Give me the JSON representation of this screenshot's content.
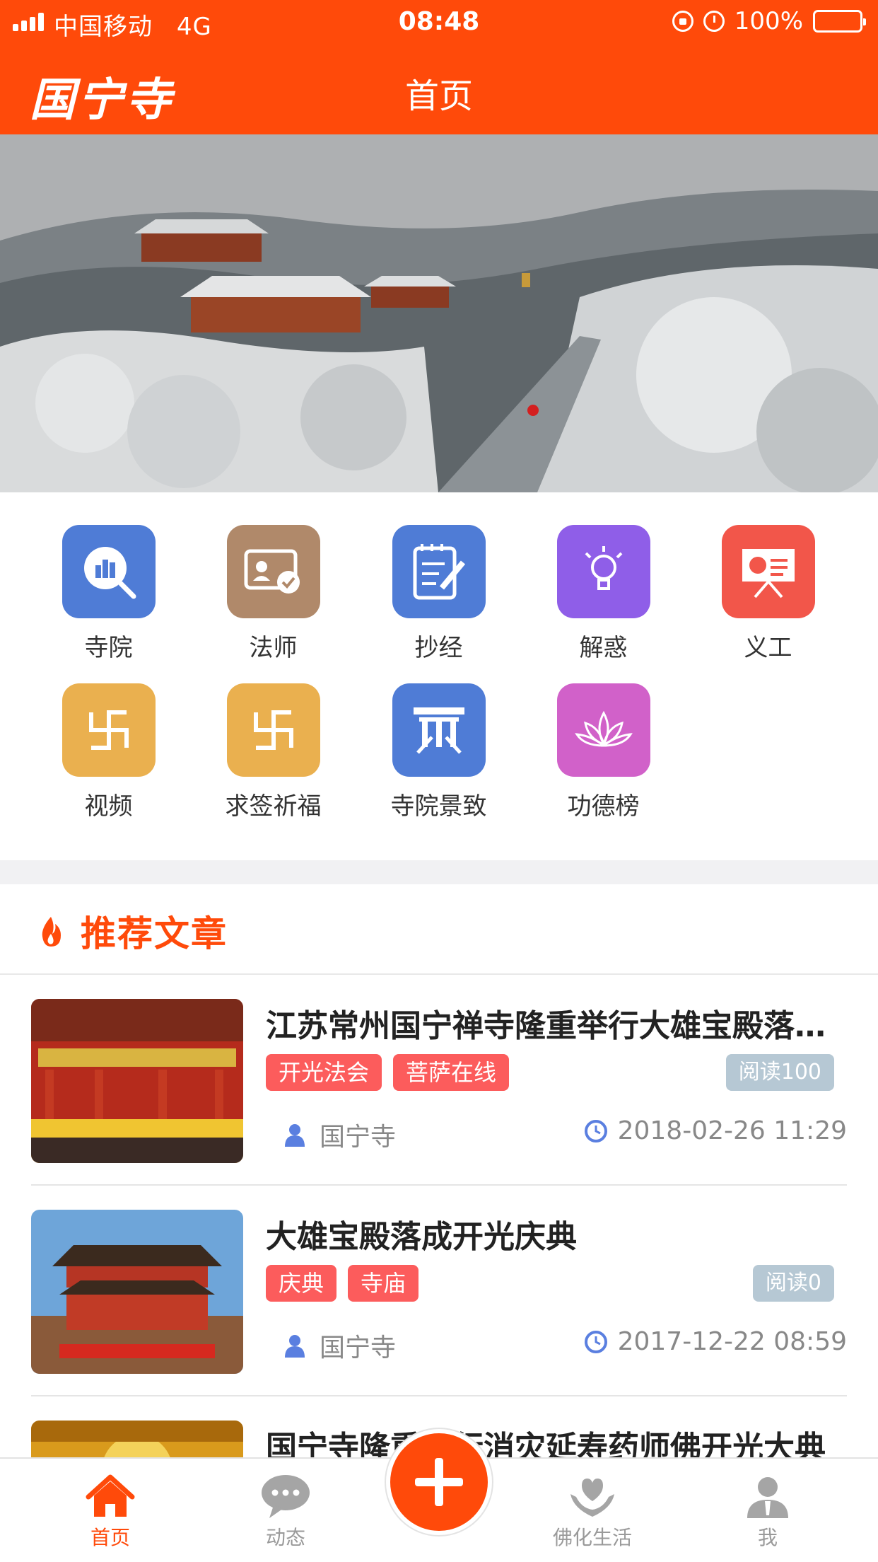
{
  "status_bar": {
    "carrier": "中国移动",
    "network": "4G",
    "time": "08:48",
    "battery": "100%"
  },
  "header": {
    "logo": "国宁寺",
    "title": "首页"
  },
  "menu": [
    {
      "label": "寺院",
      "icon": "temple-search-icon",
      "color": "#4f7cd6"
    },
    {
      "label": "法师",
      "icon": "certificate-icon",
      "color": "#b0896a"
    },
    {
      "label": "抄经",
      "icon": "notepad-pen-icon",
      "color": "#4f7cd6"
    },
    {
      "label": "解惑",
      "icon": "lightbulb-icon",
      "color": "#8f5ee8"
    },
    {
      "label": "义工",
      "icon": "presentation-board-icon",
      "color": "#f2564a"
    },
    {
      "label": "视频",
      "icon": "swastika-icon",
      "color": "#eab04f"
    },
    {
      "label": "求签祈福",
      "icon": "swastika-icon",
      "color": "#eab04f"
    },
    {
      "label": "寺院景致",
      "icon": "temple-gate-icon",
      "color": "#4f7cd6"
    },
    {
      "label": "功德榜",
      "icon": "lotus-icon",
      "color": "#d161c9"
    }
  ],
  "articles_section": {
    "title": "推荐文章"
  },
  "articles": [
    {
      "title": "江苏常州国宁禅寺隆重举行大雄宝殿落成开光法会",
      "tags": [
        "开光法会",
        "菩萨在线"
      ],
      "reads": "阅读100",
      "author": "国宁寺",
      "date": "2018-02-26 11:29"
    },
    {
      "title": "大雄宝殿落成开光庆典",
      "tags": [
        "庆典",
        "寺庙"
      ],
      "reads": "阅读0",
      "author": "国宁寺",
      "date": "2017-12-22 08:59"
    },
    {
      "title": "国宁寺隆重举行消灾延寿药师佛开光大典"
    }
  ],
  "tabbar": [
    {
      "label": "首页",
      "icon": "home-icon"
    },
    {
      "label": "动态",
      "icon": "chat-bubble-icon"
    },
    {
      "label": "佛化生活",
      "icon": "heart-hands-icon"
    },
    {
      "label": "我",
      "icon": "user-icon"
    }
  ],
  "colors": {
    "brand": "#ff4a0a",
    "tag": "#fc5c5c",
    "reads_badge": "#b6c8d4",
    "tab_inactive": "#9a9a9a"
  }
}
